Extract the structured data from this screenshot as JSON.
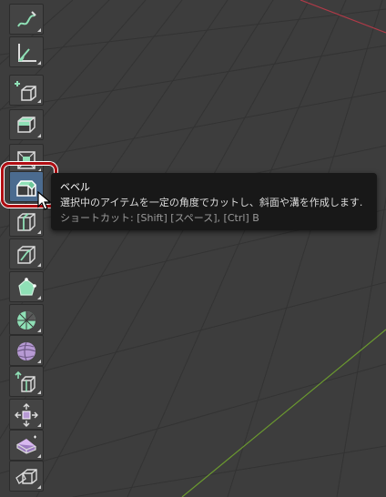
{
  "tooltip": {
    "title": "ベベル",
    "description": "選択中のアイテムを一定の角度でカットし、斜面や溝を作成します.",
    "shortcut": "ショートカット: [Shift] [スペース], [Ctrl] B"
  },
  "toolbar": {
    "tools": [
      {
        "icon": "annotate-icon"
      },
      {
        "icon": "measure-icon"
      },
      {
        "icon": "add-cube-icon"
      },
      {
        "icon": "extrude-region-icon"
      },
      {
        "icon": "inset-faces-icon"
      },
      {
        "icon": "bevel-icon",
        "active": true
      },
      {
        "icon": "loop-cut-icon"
      },
      {
        "icon": "knife-icon"
      },
      {
        "icon": "poly-build-icon"
      },
      {
        "icon": "spin-icon"
      },
      {
        "icon": "smooth-icon"
      },
      {
        "icon": "edge-slide-icon"
      },
      {
        "icon": "shrink-fatten-icon"
      },
      {
        "icon": "shear-icon"
      },
      {
        "icon": "rip-region-icon"
      }
    ]
  },
  "colors": {
    "viewport_bg": "#3d3d3d",
    "grid": "#333333",
    "x_axis": "#b03a48",
    "y_axis": "#6b9a2f",
    "tool_accent": "#8fe0b6",
    "highlight_ring": "#b00d12",
    "tooltip_bg": "#181818"
  }
}
